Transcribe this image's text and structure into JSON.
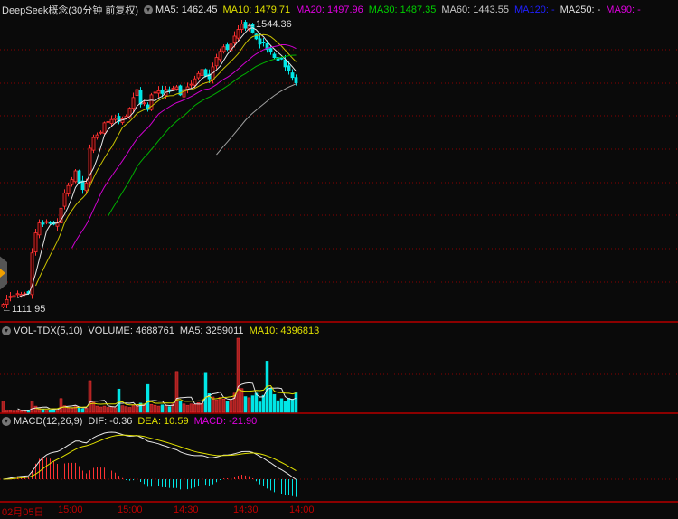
{
  "main": {
    "title": "DeepSeek概念(30分钟 前复权)",
    "indicators": [
      {
        "label": "MA5: 1462.45",
        "color": "#e0e0e0"
      },
      {
        "label": "MA10: 1479.71",
        "color": "#e0e000"
      },
      {
        "label": "MA20: 1497.96",
        "color": "#e000e0"
      },
      {
        "label": "MA30: 1487.35",
        "color": "#00d000"
      },
      {
        "label": "MA60: 1443.55",
        "color": "#c8c8c8"
      },
      {
        "label": "MA120: -",
        "color": "#2020ff"
      },
      {
        "label": "MA250: -",
        "color": "#e0e0e0"
      },
      {
        "label": "MA90: -",
        "color": "#e000e0"
      }
    ],
    "high_label": "1544.36",
    "low_label": "1111.95"
  },
  "volume": {
    "title": "VOL-TDX(5,10)",
    "volume": "VOLUME: 4688761",
    "ma5": "MA5: 3259011",
    "ma10": "MA10: 4396813"
  },
  "macd": {
    "title": "MACD(12,26,9)",
    "dif": "DIF: -0.36",
    "dea": "DEA: 10.59",
    "macd": "MACD: -21.90"
  },
  "time_axis": [
    "02月05日",
    "15:00",
    "15:00",
    "14:30",
    "14:30",
    "14:00"
  ],
  "colors": {
    "up": "#ff3232",
    "down": "#00e6e6",
    "grid": "#8b0000"
  },
  "chart_data": {
    "type": "candlestick",
    "price_range": [
      1111.95,
      1544.36
    ],
    "close": [
      1118,
      1125,
      1130,
      1131,
      1134,
      1133,
      1134,
      1134,
      1195,
      1225,
      1240,
      1238,
      1242,
      1240,
      1238,
      1240,
      1262,
      1285,
      1296,
      1305,
      1318,
      1300,
      1290,
      1300,
      1352,
      1368,
      1372,
      1376,
      1390,
      1392,
      1395,
      1397,
      1392,
      1396,
      1400,
      1412,
      1428,
      1440,
      1418,
      1420,
      1410,
      1432,
      1436,
      1438,
      1434,
      1440,
      1438,
      1442,
      1444,
      1432,
      1440,
      1444,
      1448,
      1456,
      1464,
      1470,
      1460,
      1456,
      1474,
      1488,
      1497,
      1504,
      1500,
      1508,
      1520,
      1530,
      1538,
      1532,
      1536,
      1526,
      1516,
      1508,
      1510,
      1500,
      1496,
      1488,
      1484,
      1486,
      1474,
      1468,
      1458,
      1450
    ],
    "volume": [
      2700000,
      600000,
      400000,
      300000,
      500000,
      400000,
      300000,
      400000,
      2700000,
      1500000,
      900000,
      700000,
      600000,
      500000,
      700000,
      600000,
      3300000,
      1600000,
      1200000,
      1000000,
      1400000,
      1300000,
      900000,
      1000000,
      7600000,
      2400000,
      1500000,
      1300000,
      1500000,
      1200000,
      1400000,
      1100000,
      5600000,
      1600000,
      1400000,
      1200000,
      1800000,
      1500000,
      2200000,
      1700000,
      6700000,
      1900000,
      1700000,
      1500000,
      1800000,
      1700000,
      1400000,
      2000000,
      9800000,
      2600000,
      2000000,
      1700000,
      2000000,
      1900000,
      2300000,
      2100000,
      9600000,
      4500000,
      3700000,
      3000000,
      3600000,
      3200000,
      2600000,
      2900000,
      4600000,
      17800000,
      5700000,
      3800000,
      3500000,
      4000000,
      4600000,
      2500000,
      4100000,
      12300000,
      5800000,
      4300000,
      2800000,
      3300000,
      2600000,
      3400000,
      3200000,
      4688761
    ],
    "ma_periods": [
      5,
      10,
      20,
      30,
      60
    ]
  }
}
